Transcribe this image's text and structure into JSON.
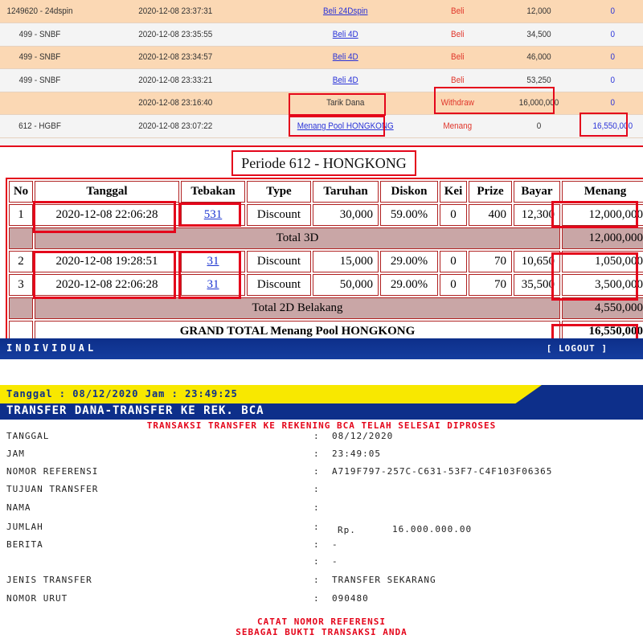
{
  "history": {
    "rows": [
      {
        "id": "1249620 - 24dspin",
        "date": "2020-12-08 23:37:31",
        "desc": "Beli 24Dspin",
        "type": "Beli",
        "amount": "12,000",
        "balance": "0",
        "link": true
      },
      {
        "id": "499 - SNBF",
        "date": "2020-12-08 23:35:55",
        "desc": "Beli 4D",
        "type": "Beli",
        "amount": "34,500",
        "balance": "0",
        "link": true
      },
      {
        "id": "499 - SNBF",
        "date": "2020-12-08 23:34:57",
        "desc": "Beli 4D",
        "type": "Beli",
        "amount": "46,000",
        "balance": "0",
        "link": true
      },
      {
        "id": "499 - SNBF",
        "date": "2020-12-08 23:33:21",
        "desc": "Beli 4D",
        "type": "Beli",
        "amount": "53,250",
        "balance": "0",
        "link": true
      },
      {
        "id": "",
        "date": "2020-12-08 23:16:40",
        "desc": "Tarik Dana",
        "type": "Withdraw",
        "amount": "16,000,000",
        "balance": "0",
        "link": false
      },
      {
        "id": "612 - HGBF",
        "date": "2020-12-08 23:07:22",
        "desc": "Menang Pool HONGKONG",
        "type": "Menang",
        "amount": "0",
        "balance": "16,550,000",
        "link": true
      }
    ]
  },
  "periode": {
    "title": "Periode 612 - HONGKONG",
    "headers": [
      "No",
      "Tanggal",
      "Tebakan",
      "Type",
      "Taruhan",
      "Diskon",
      "Kei",
      "Prize",
      "Bayar",
      "Menang"
    ],
    "rows3d": [
      {
        "no": "1",
        "tanggal": "2020-12-08 22:06:28",
        "tebakan": "531",
        "type": "Discount",
        "taruhan": "30,000",
        "diskon": "59.00%",
        "kei": "0",
        "prize": "400",
        "bayar": "12,300",
        "menang": "12,000,000"
      }
    ],
    "total3d_label": "Total 3D",
    "total3d_value": "12,000,000",
    "rows2d": [
      {
        "no": "2",
        "tanggal": "2020-12-08 19:28:51",
        "tebakan": "31",
        "type": "Discount",
        "taruhan": "15,000",
        "diskon": "29.00%",
        "kei": "0",
        "prize": "70",
        "bayar": "10,650",
        "menang": "1,050,000"
      },
      {
        "no": "3",
        "tanggal": "2020-12-08 22:06:28",
        "tebakan": "31",
        "type": "Discount",
        "taruhan": "50,000",
        "diskon": "29.00%",
        "kei": "0",
        "prize": "70",
        "bayar": "35,500",
        "menang": "3,500,000"
      }
    ],
    "total2d_label": "Total 2D Belakang",
    "total2d_value": "4,550,000",
    "grand_label": "GRAND TOTAL  Menang Pool HONGKONG",
    "grand_value": "16,550,000"
  },
  "bank": {
    "header": "INDIVIDUAL",
    "logout": "[ LOGOUT ]",
    "date_line": "Tanggal : 08/12/2020 Jam : 23:49:25",
    "title": "TRANSFER DANA-TRANSFER KE REK. BCA",
    "status": "TRANSAKSI TRANSFER KE REKENING BCA TELAH SELESAI DIPROSES",
    "fields": {
      "tanggal_label": "TANGGAL",
      "tanggal": "08/12/2020",
      "jam_label": "JAM",
      "jam": "23:49:05",
      "ref_label": "NOMOR REFERENSI",
      "ref": "A719F797-257C-C631-53F7-C4F103F06365",
      "tujuan_label": "TUJUAN TRANSFER",
      "tujuan": "",
      "nama_label": "NAMA",
      "nama": "",
      "jumlah_label": "JUMLAH",
      "currency": "Rp.",
      "jumlah": "16.000.000.00",
      "berita_label": "BERITA",
      "berita1": "-",
      "berita2": "-",
      "jenis_label": "JENIS TRANSFER",
      "jenis": "TRANSFER SEKARANG",
      "urut_label": "NOMOR URUT",
      "urut": "090480"
    },
    "separator": ":",
    "note1": "CATAT NOMOR REFERENSI",
    "note2": "SEBAGAI BUKTI TRANSAKSI ANDA"
  }
}
